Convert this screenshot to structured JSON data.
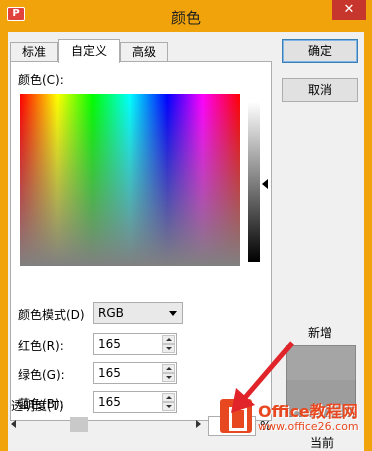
{
  "window": {
    "title": "颜色",
    "close_icon": "close-icon",
    "app_icon": "wps-app-icon"
  },
  "tabs": [
    {
      "label": "标准",
      "active": false
    },
    {
      "label": "自定义",
      "active": true
    },
    {
      "label": "高级",
      "active": false
    }
  ],
  "custom": {
    "color_label": "颜色(C):",
    "mode_label": "颜色模式(D)",
    "mode_value": "RGB",
    "red_label": "红色(R):",
    "red_value": "165",
    "green_label": "绿色(G):",
    "green_value": "165",
    "blue_label": "蓝色(B):",
    "blue_value": "165",
    "transparency_label": "透明度(T)",
    "percent_sign": "%"
  },
  "buttons": {
    "ok": "确定",
    "cancel": "取消"
  },
  "preview": {
    "new_label": "新增",
    "current_label": "当前",
    "new_color": "#a5a5a5"
  },
  "watermark": {
    "title": "Office教程网",
    "url": "www.office26.com"
  },
  "colors": {
    "titlebar": "#f0a30a",
    "close": "#c7362c",
    "arrow": "#e0242a"
  }
}
